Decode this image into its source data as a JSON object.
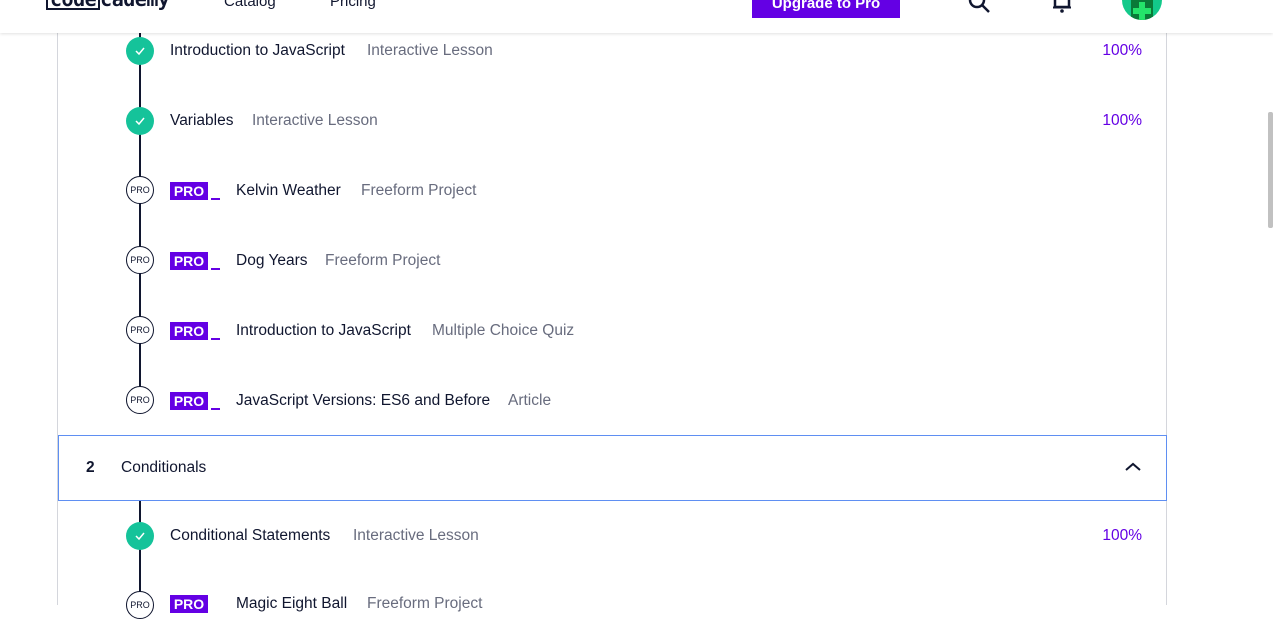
{
  "nav": {
    "logo_a": "code",
    "logo_b": "cademy",
    "catalog": "Catalog",
    "pricing": "Pricing",
    "upgrade": "Upgrade to Pro",
    "search_icon": "search-icon",
    "bell_icon": "bell-icon"
  },
  "lessons_module1": [
    {
      "title": "Introduction to JavaScript",
      "type": "Interactive Lesson",
      "status": "done",
      "progress": "100%"
    },
    {
      "title": "Variables",
      "type": "Interactive Lesson",
      "status": "done",
      "progress": "100%"
    },
    {
      "title": "Kelvin Weather",
      "type": "Freeform Project",
      "status": "pro",
      "badge": "PRO",
      "node_label": "PRO"
    },
    {
      "title": "Dog Years",
      "type": "Freeform Project",
      "status": "pro",
      "badge": "PRO",
      "node_label": "PRO"
    },
    {
      "title": "Introduction to JavaScript",
      "type": "Multiple Choice Quiz",
      "status": "pro",
      "badge": "PRO",
      "node_label": "PRO"
    },
    {
      "title": "JavaScript Versions: ES6 and Before",
      "type": "Article",
      "status": "pro",
      "badge": "PRO",
      "node_label": "PRO"
    }
  ],
  "module2": {
    "number": "2",
    "name": "Conditionals",
    "expanded": true,
    "lessons": [
      {
        "title": "Conditional Statements",
        "type": "Interactive Lesson",
        "status": "done",
        "progress": "100%"
      },
      {
        "title": "Magic Eight Ball",
        "type": "Freeform Project",
        "status": "pro",
        "badge": "PRO",
        "node_label": "PRO"
      }
    ]
  },
  "colors": {
    "accent": "#6400e4",
    "done": "#15c39a",
    "text": "#10162f",
    "muted": "#686c7e",
    "header_border": "#5f8ff2"
  }
}
